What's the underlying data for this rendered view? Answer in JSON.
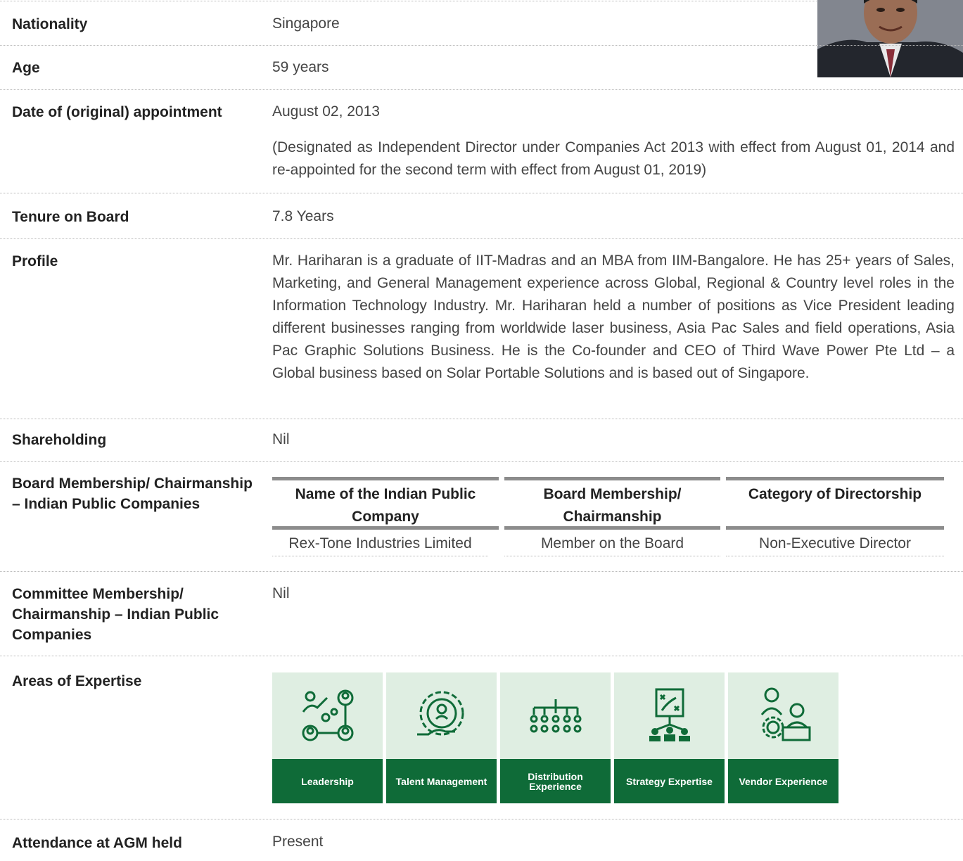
{
  "rows": {
    "nationality": {
      "label": "Nationality",
      "value": "Singapore"
    },
    "age": {
      "label": "Age",
      "value": "59 years"
    },
    "appointment": {
      "label": "Date of (original) appointment",
      "value": "August 02, 2013",
      "note": "(Designated as Independent Director under Companies Act 2013 with effect from August 01, 2014 and re-appointed for the second term with effect from August 01, 2019)"
    },
    "tenure": {
      "label": "Tenure on Board",
      "value": "7.8 Years"
    },
    "profile": {
      "label": "Profile",
      "value": "Mr. Hariharan is a graduate of IIT-Madras and an MBA from IIM-Bangalore. He has 25+ years of Sales, Marketing, and General Management experience across Global, Regional & Country level roles in the Information Technology Industry. Mr. Hariharan held a number of positions as Vice President leading different businesses ranging from worldwide laser business, Asia Pac Sales and field operations, Asia Pac Graphic Solutions Business. He is the Co-founder and CEO of Third Wave Power Pte Ltd – a Global business based on Solar Portable Solutions and is based out of Singapore."
    },
    "shareholding": {
      "label": "Shareholding",
      "value": "Nil"
    },
    "board": {
      "label": "Board Membership/ Chairmanship – Indian Public Companies",
      "headers": [
        "Name of the Indian Public Company",
        "Board Membership/ Chairmanship",
        "Category of Directorship"
      ],
      "cells": [
        "Rex-Tone Industries Limited",
        "Member on the Board",
        "Non-Executive Director"
      ]
    },
    "committee": {
      "label": "Committee Membership/ Chairmanship – Indian Public Companies",
      "value": "Nil"
    },
    "expertise": {
      "label": "Areas of Expertise",
      "tiles": [
        {
          "label": "Leadership",
          "icon": "leadership-icon"
        },
        {
          "label": "Talent Management",
          "icon": "talent-management-icon"
        },
        {
          "label": "Distribution Experience",
          "icon": "distribution-icon"
        },
        {
          "label": "Strategy Expertise",
          "icon": "strategy-icon"
        },
        {
          "label": "Vendor Experience",
          "icon": "vendor-icon"
        }
      ]
    },
    "attendance": {
      "label": "Attendance at AGM held",
      "value": "Present"
    }
  },
  "colors": {
    "accent_green": "#0f6b38",
    "tile_bg": "#dfeee2",
    "rule": "#b9b9b9"
  }
}
